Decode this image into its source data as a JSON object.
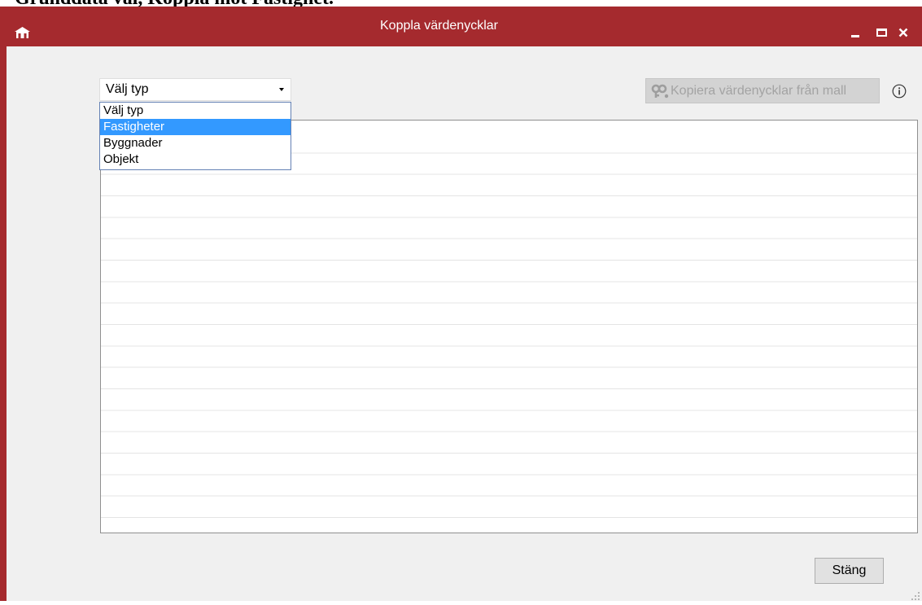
{
  "document_heading": "Grunddata val, Koppla mot Fastighet.",
  "window": {
    "title": "Koppla värdenycklar",
    "app_icon": "house-icon",
    "controls": [
      "minimize-icon",
      "maximize-icon",
      "close-icon"
    ],
    "accent_color": "#a52a2e"
  },
  "type_select": {
    "selected": "Välj typ",
    "expanded": true,
    "highlight_color": "#3399ff",
    "options": [
      {
        "label": "Välj typ",
        "highlighted": false
      },
      {
        "label": "Fastigheter",
        "highlighted": true
      },
      {
        "label": "Byggnader",
        "highlighted": false
      },
      {
        "label": "Objekt",
        "highlighted": false
      }
    ]
  },
  "copy_button": {
    "label": "Kopiera värdenycklar från mall",
    "icon": "key-link-icon",
    "enabled": false
  },
  "info_button": {
    "icon": "info-icon"
  },
  "value_key_grid": {
    "rows": []
  },
  "footer": {
    "close_label": "Stäng"
  },
  "resize_grip": {
    "icon": "resize-grip-icon"
  }
}
